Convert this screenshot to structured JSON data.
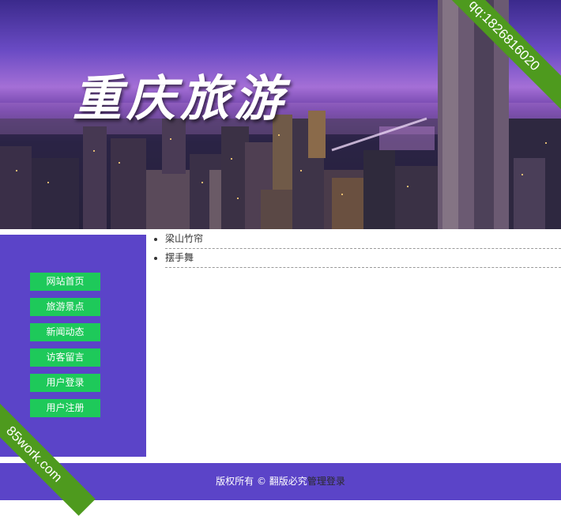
{
  "banner": {
    "title": "重庆旅游",
    "corner_ribbon": "qq:1826816020"
  },
  "watermark": {
    "text": "85work.com"
  },
  "sidebar": {
    "nav": [
      {
        "label": "网站首页"
      },
      {
        "label": "旅游景点"
      },
      {
        "label": "新闻动态"
      },
      {
        "label": "访客留言"
      },
      {
        "label": "用户登录"
      },
      {
        "label": "用户注册"
      }
    ]
  },
  "main": {
    "items": [
      {
        "label": "梁山竹帘"
      },
      {
        "label": "摆手舞"
      }
    ]
  },
  "footer": {
    "copyright": "版权所有 © 翻版必究",
    "admin_link": "管理登录"
  },
  "colors": {
    "nav_bg": "#5b44c8",
    "button_bg": "#1ec95a",
    "ribbon_bg": "#4e9a1e"
  }
}
